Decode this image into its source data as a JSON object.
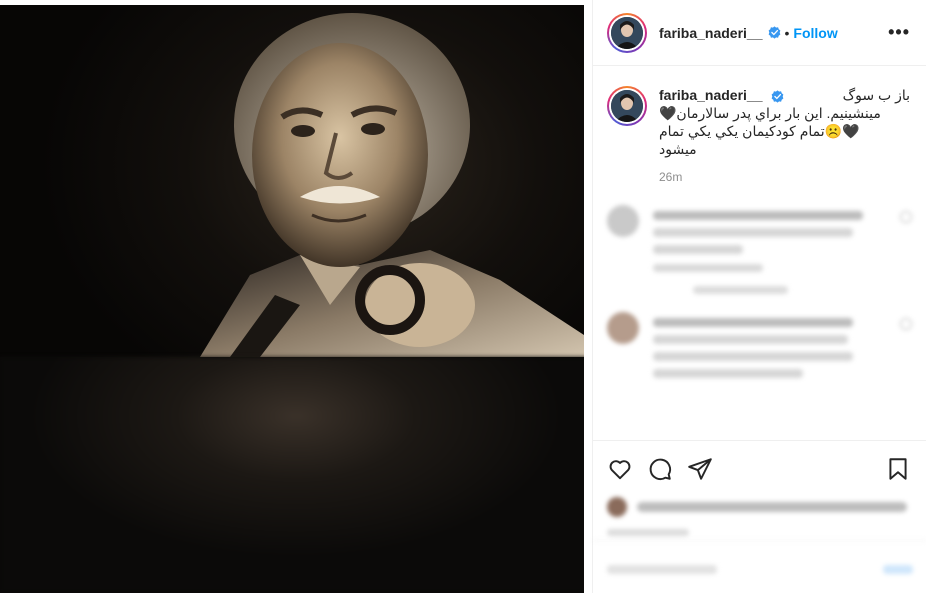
{
  "post": {
    "username": "fariba_naderi__",
    "follow_label": "Follow",
    "more_label": "•••",
    "separator": "•",
    "caption_line1": "باز ب سوگ",
    "caption_line2": "مینشینیم. این بار براي پدر سالارمان🖤",
    "caption_line3": "🖤☹️تمام کودکیمان یکي یکي تمام",
    "caption_line4": "میشود",
    "timestamp": "26m"
  },
  "colors": {
    "accent": "#0095f6",
    "verified": "#3897f0",
    "text": "#262626",
    "muted": "#8e8e8e"
  },
  "icons": [
    "verified-badge-icon",
    "more-options-icon",
    "heart-icon",
    "comment-icon",
    "share-icon",
    "save-icon"
  ]
}
